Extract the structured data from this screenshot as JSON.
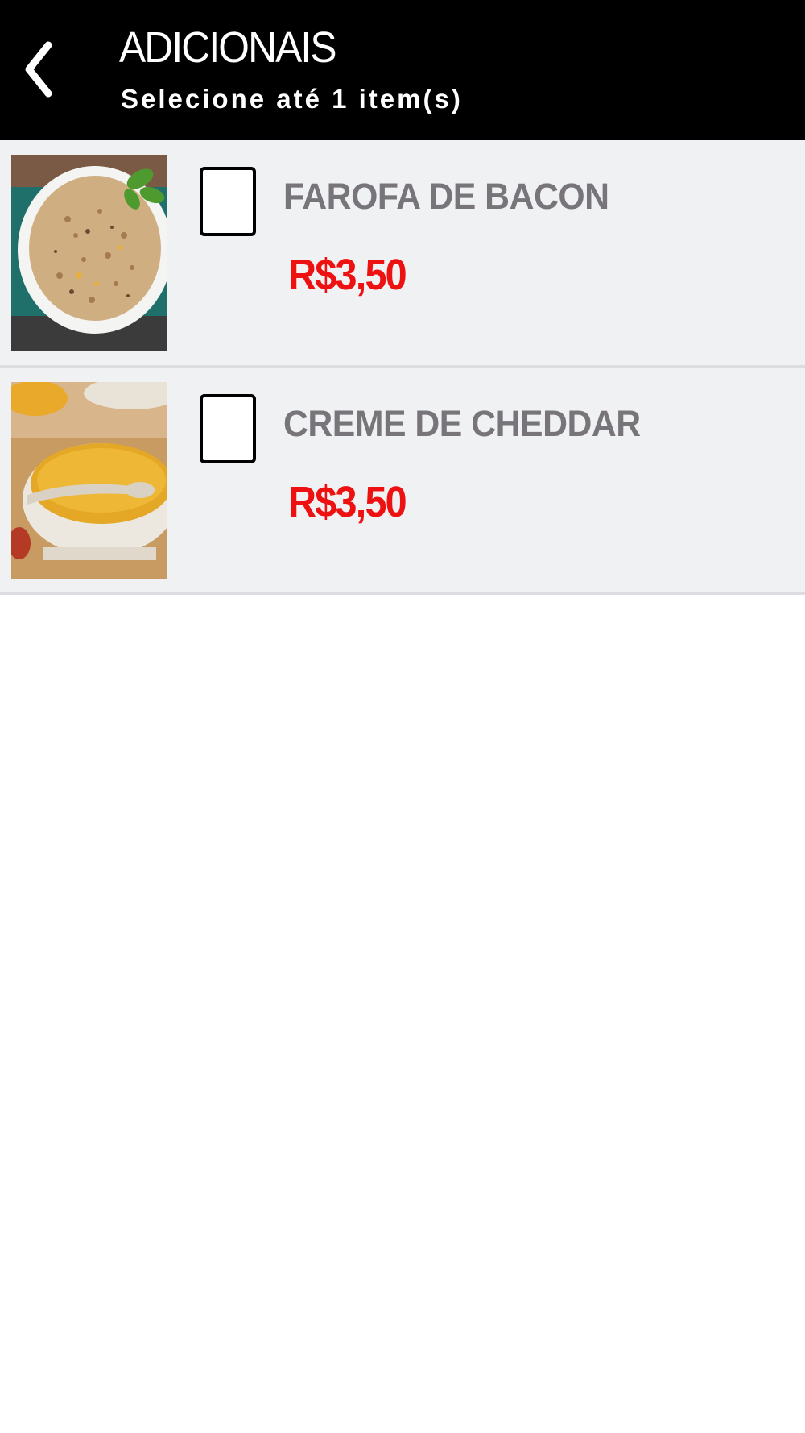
{
  "header": {
    "title": "ADICIONAIS",
    "subtitle": "Selecione até 1 item(s)",
    "back_icon": "chevron-left-icon"
  },
  "items": [
    {
      "name": "FAROFA DE BACON",
      "price": "R$3,50",
      "checked": false,
      "image": "farofa-bowl-photo"
    },
    {
      "name": "CREME DE CHEDDAR",
      "price": "R$3,50",
      "checked": false,
      "image": "cheddar-cream-bowl-photo"
    }
  ],
  "colors": {
    "header_bg": "#000000",
    "item_bg": "#f0f1f3",
    "name_text": "#77757a",
    "price_text": "#ee1111"
  }
}
